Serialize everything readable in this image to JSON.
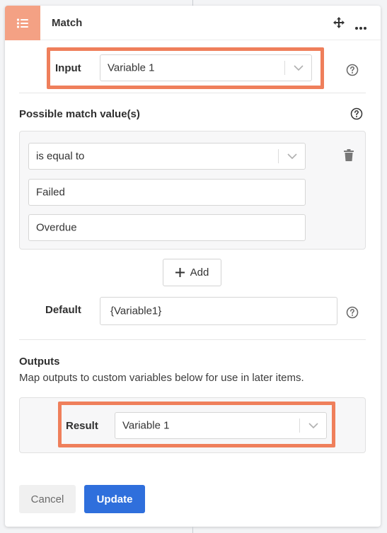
{
  "header": {
    "title": "Match",
    "icon": "list-icon",
    "accent": "#f4a184"
  },
  "input": {
    "label": "Input",
    "value": "Variable 1"
  },
  "match_values": {
    "title": "Possible match value(s)",
    "operator": "is equal to",
    "values": [
      "Failed",
      "Overdue"
    ]
  },
  "add_button": {
    "label": "Add"
  },
  "default": {
    "label": "Default",
    "value": "{Variable1}"
  },
  "outputs": {
    "title": "Outputs",
    "description": "Map outputs to custom variables below for use in later items.",
    "result_label": "Result",
    "result_value": "Variable 1"
  },
  "footer": {
    "cancel_label": "Cancel",
    "update_label": "Update"
  },
  "colors": {
    "highlight": "#ef7f5b",
    "primary": "#2f6fdc"
  }
}
